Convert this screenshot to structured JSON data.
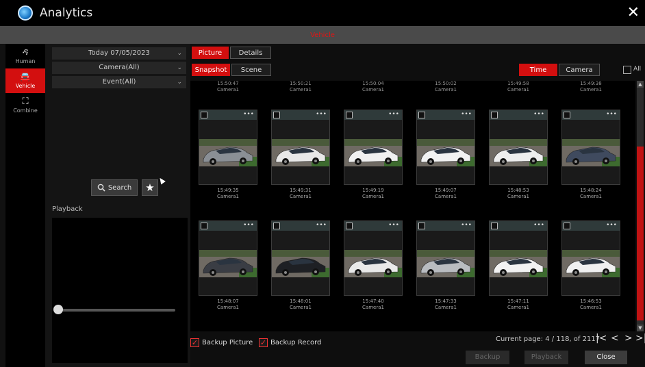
{
  "window": {
    "title": "Analytics",
    "subtitle": "Vehicle"
  },
  "nav": [
    {
      "label": "Human",
      "icon": "human-icon"
    },
    {
      "label": "Vehicle",
      "icon": "vehicle-icon"
    },
    {
      "label": "Combine",
      "icon": "combine-icon"
    }
  ],
  "filters": {
    "date": "Today 07/05/2023",
    "camera": "Camera(All)",
    "event": "Event(All)"
  },
  "search": {
    "label": "Search"
  },
  "playback": {
    "label": "Playback"
  },
  "tabs": {
    "picture": "Picture",
    "details": "Details",
    "snapshot": "Snapshot",
    "scene": "Scene",
    "time": "Time",
    "camera": "Camera",
    "all": "All"
  },
  "top_row": [
    {
      "time": "15:50:47",
      "camera": "Camera1"
    },
    {
      "time": "15:50:21",
      "camera": "Camera1"
    },
    {
      "time": "15:50:04",
      "camera": "Camera1"
    },
    {
      "time": "15:50:02",
      "camera": "Camera1"
    },
    {
      "time": "15:49:58",
      "camera": "Camera1"
    },
    {
      "time": "15:49:38",
      "camera": "Camera1"
    }
  ],
  "rows": [
    [
      {
        "time": "15:49:35",
        "camera": "Camera1",
        "car": "#8a8f95"
      },
      {
        "time": "15:49:31",
        "camera": "Camera1",
        "car": "#e8e8e8"
      },
      {
        "time": "15:49:19",
        "camera": "Camera1",
        "car": "#f0f0f0"
      },
      {
        "time": "15:49:07",
        "camera": "Camera1",
        "car": "#f2f2f2"
      },
      {
        "time": "15:48:53",
        "camera": "Camera1",
        "car": "#eeeeee"
      },
      {
        "time": "15:48:24",
        "camera": "Camera1",
        "car": "#3f4a5e"
      }
    ],
    [
      {
        "time": "15:48:07",
        "camera": "Camera1",
        "car": "#3a3d44"
      },
      {
        "time": "15:48:01",
        "camera": "Camera1",
        "car": "#1e2024"
      },
      {
        "time": "15:47:40",
        "camera": "Camera1",
        "car": "#e9e9e9"
      },
      {
        "time": "15:47:33",
        "camera": "Camera1",
        "car": "#b9bcc0"
      },
      {
        "time": "15:47:11",
        "camera": "Camera1",
        "car": "#f2f2f2"
      },
      {
        "time": "15:46:53",
        "camera": "Camera1",
        "car": "#f0f0f0"
      }
    ]
  ],
  "footer": {
    "backup_picture": "Backup Picture",
    "backup_record": "Backup Record",
    "page_info": "Current page: 4 / 118, of 2117",
    "backup": "Backup",
    "playback": "Playback",
    "close": "Close"
  },
  "colors": {
    "accent": "#d30f0f",
    "background": "#111111"
  }
}
